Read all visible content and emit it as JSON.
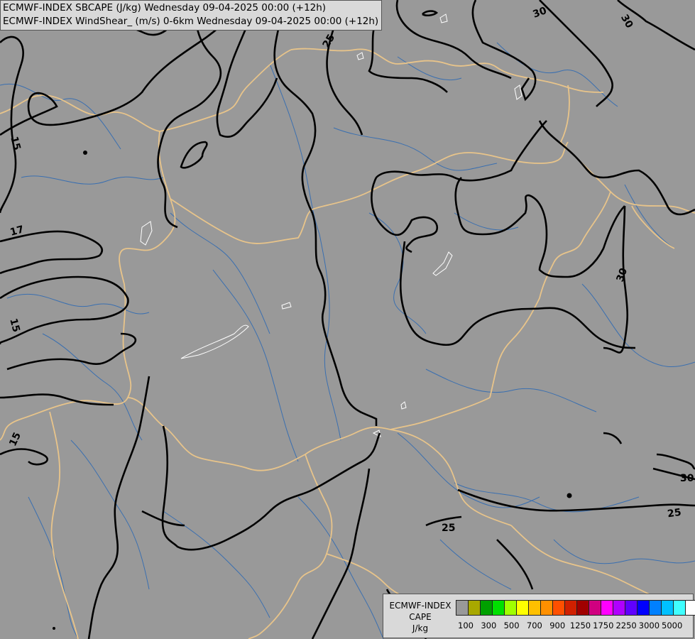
{
  "header": {
    "line1": "ECMWF-INDEX SBCAPE (J/kg) Wednesday 09-04-2025 00:00 (+12h)",
    "line2": "ECMWF-INDEX WindShear_ (m/s) 0-6km Wednesday 09-04-2025 00:00 (+12h)"
  },
  "contour_labels": [
    "30",
    "30",
    "25",
    "15",
    "17",
    "15",
    "15",
    "30",
    "30",
    "25",
    "25"
  ],
  "legend": {
    "title_lines": [
      "ECMWF-INDEX",
      "CAPE",
      "J/kg"
    ],
    "colors": [
      "#999999",
      "#a8a800",
      "#00a000",
      "#00e000",
      "#a0ff00",
      "#ffff00",
      "#ffc000",
      "#ff9000",
      "#ff5000",
      "#d02000",
      "#a00000",
      "#d00080",
      "#ff00ff",
      "#b000ff",
      "#6000ff",
      "#0000ff",
      "#0080ff",
      "#00c0ff",
      "#40ffff",
      "#ffffff"
    ],
    "tick_labels": [
      "100",
      "300",
      "500",
      "700",
      "900",
      "1250",
      "1750",
      "2250",
      "3000",
      "5000"
    ]
  }
}
